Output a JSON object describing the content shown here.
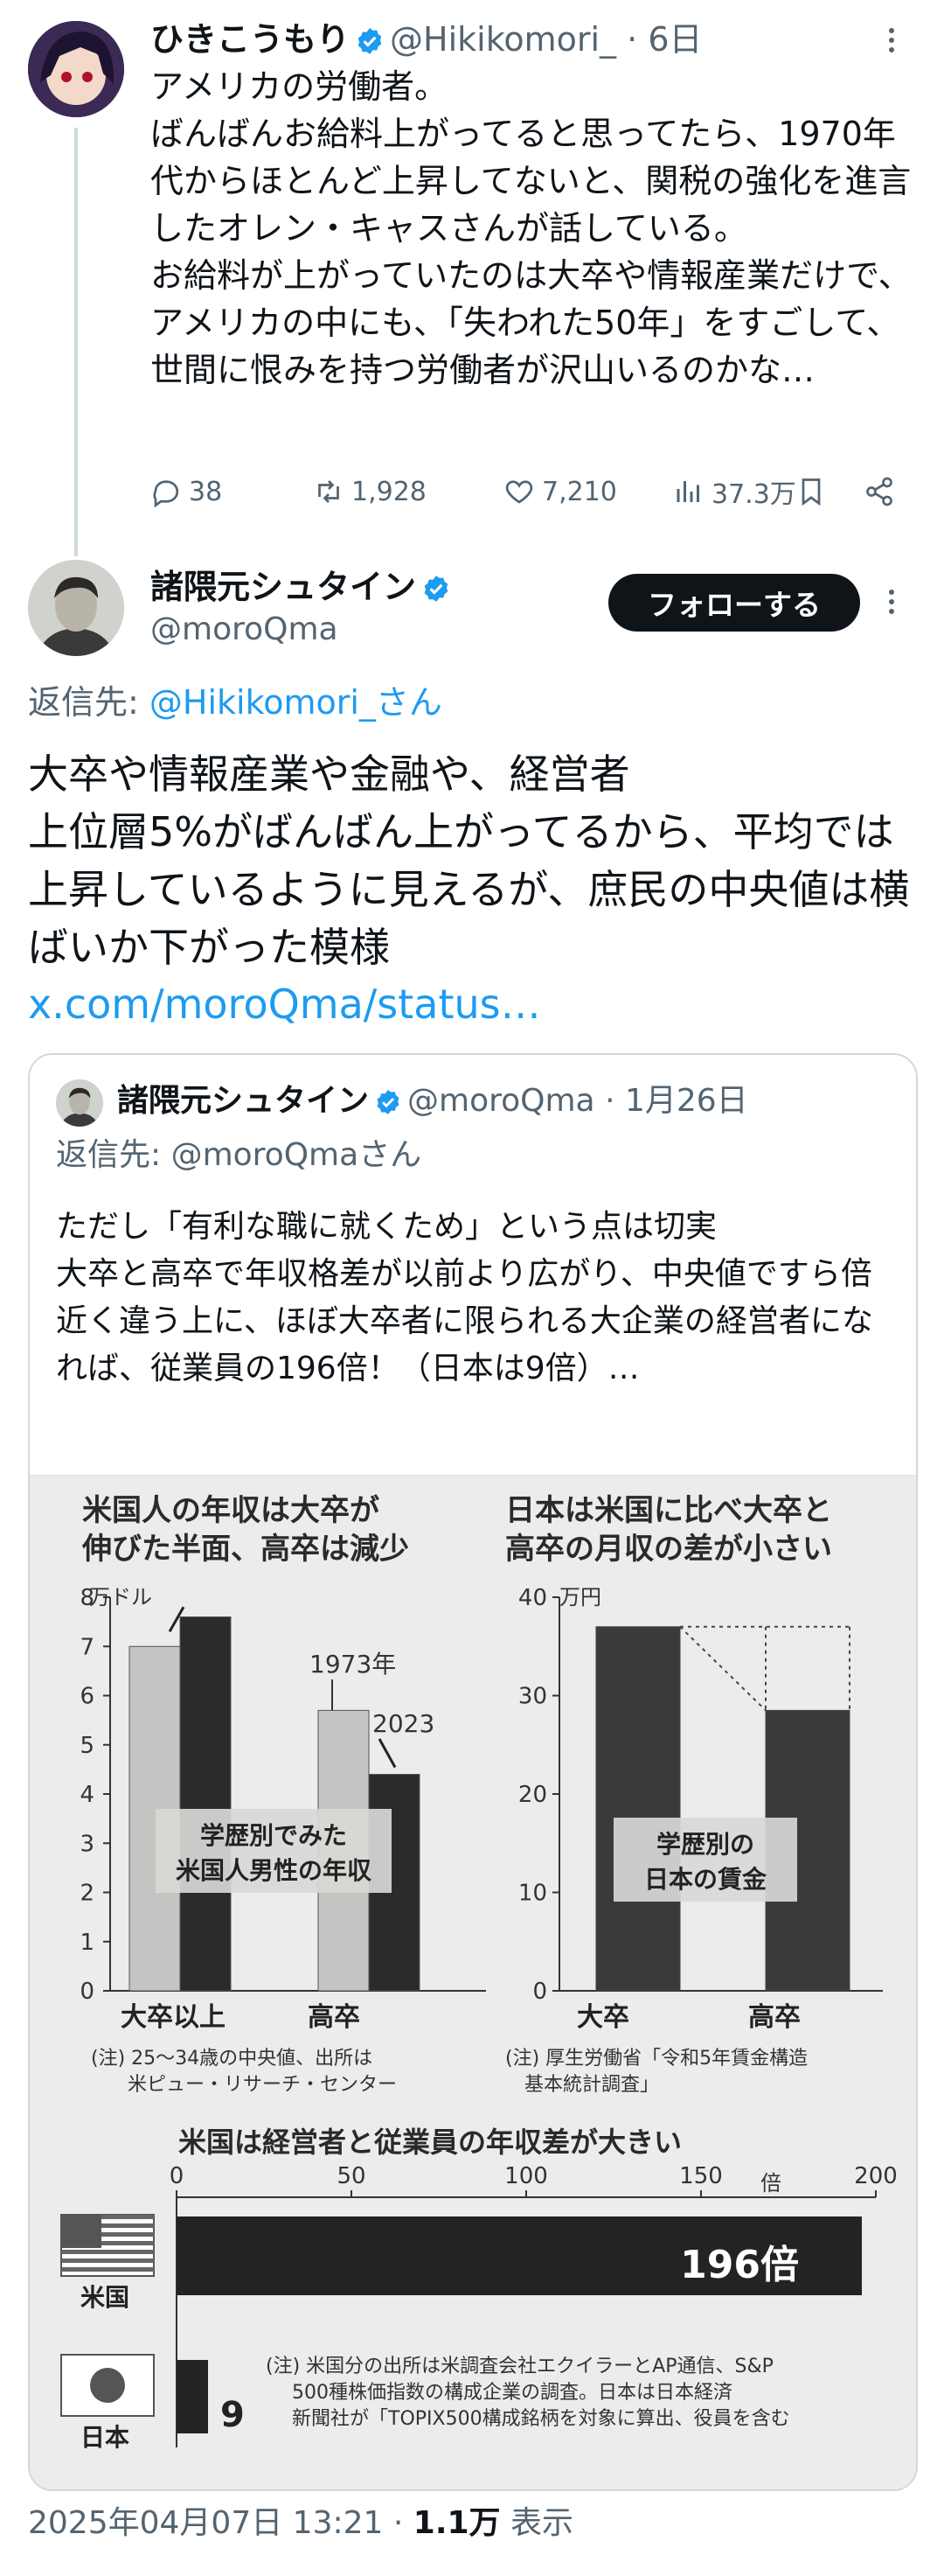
{
  "parent_tweet": {
    "name": "ひきこうもり",
    "handle": "@Hikikomori_",
    "time": "· 6日",
    "text": "アメリカの労働者。\nばんばんお給料上がってると思ってたら、1970年代からほとんど上昇してないと、関税の強化を進言したオレン・キャスさんが話している。\nお給料が上がっていたのは大卒や情報産業だけで、アメリカの中にも、「失われた50年」をすごして、世間に恨みを持つ労働者が沢山いるのかな…",
    "replies": "38",
    "retweets": "1,928",
    "likes": "7,210",
    "views": "37.3万"
  },
  "reply_tweet": {
    "name": "諸隈元シュタイン",
    "handle": "@moroQma",
    "follow_label": "フォローする",
    "reply_to_prefix": "返信先: ",
    "reply_to_target": "@Hikikomori_さん",
    "text": "大卒や情報産業や金融や、経営者\n上位層5%がばんばん上がってるから、平均では上昇しているように見えるが、庶民の中央値は横ばいか下がった模様",
    "link": "x.com/moroQma/status…"
  },
  "quote_tweet": {
    "name": "諸隈元シュタイン",
    "handle": "@moroQma",
    "time": "· 1月26日",
    "reply_to": "返信先: @moroQmaさん",
    "text": "ただし「有利な職に就くため」という点は切実\n大卒と高卒で年収格差が以前より広がり、中央値ですら倍近く違う上に、ほぼ大卒者に限られる大企業の経営者になれば、従業員の196倍！（日本は9倍）…"
  },
  "clipping": {
    "chart1": {
      "title_line1": "米国人の年収は大卒が",
      "title_line2": "伸びた半面、高卒は減少",
      "unit": "万ドル",
      "label_1973": "1973年",
      "label_2023": "2023",
      "center_line1": "学歴別でみた",
      "center_line2": "米国人男性の年収",
      "cat1": "大卒以上",
      "cat2": "高卒",
      "note_line1": "(注) 25～34歳の中央値、出所は",
      "note_line2": "米ピュー・リサーチ・センター"
    },
    "chart2": {
      "title_line1": "日本は米国に比べ大卒と",
      "title_line2": "高卒の月収の差が小さい",
      "unit": "万円",
      "center_line1": "学歴別の",
      "center_line2": "日本の賃金",
      "cat1": "大卒",
      "cat2": "高卒",
      "note_line1": "(注) 厚生労働省「令和5年賃金構造",
      "note_line2": "基本統計調査」"
    },
    "chart3": {
      "title": "米国は経営者と従業員の年収差が大きい",
      "unit": "倍",
      "label_us": "米国",
      "label_jp": "日本",
      "value_us_label": "196倍",
      "value_jp_label": "9",
      "note_line1": "(注) 米国分の出所は米調査会社エクイラーとAP通信、S&P",
      "note_line2": "500種株価指数の構成企業の調査。日本は日本経済",
      "note_line3": "新聞社が「TOPIX500構成銘柄を対象に算出、役員を含む"
    }
  },
  "chart_data": [
    {
      "type": "bar",
      "title": "米国人の年収は大卒が伸びた半面、高卒は減少",
      "categories": [
        "大卒以上",
        "高卒"
      ],
      "series": [
        {
          "name": "1973年",
          "values": [
            7.0,
            5.7
          ]
        },
        {
          "name": "2023",
          "values": [
            7.6,
            4.4
          ]
        }
      ],
      "ylabel": "万ドル",
      "ylim": [
        0,
        8
      ],
      "yticks": [
        0,
        1,
        2,
        3,
        4,
        5,
        6,
        7,
        8
      ]
    },
    {
      "type": "bar",
      "title": "日本は米国に比べ大卒と高卒の月収の差が小さい",
      "categories": [
        "大卒",
        "高卒"
      ],
      "values": [
        37,
        28.5
      ],
      "ylabel": "万円",
      "ylim": [
        0,
        40
      ],
      "yticks": [
        0,
        10,
        20,
        30,
        40
      ]
    },
    {
      "type": "bar",
      "title": "米国は経営者と従業員の年収差が大きい",
      "categories": [
        "米国",
        "日本"
      ],
      "values": [
        196,
        9
      ],
      "xlabel": "倍",
      "xlim": [
        0,
        200
      ],
      "xticks": [
        0,
        50,
        100,
        150,
        200
      ]
    }
  ],
  "footer": {
    "datetime": "2025年04月07日 13:21 · ",
    "views": "1.1万",
    "views_suffix": " 表示"
  },
  "colors": {
    "accent": "#1d9bf0",
    "text": "#0f1419",
    "muted": "#536471",
    "border": "#cfd9de"
  }
}
